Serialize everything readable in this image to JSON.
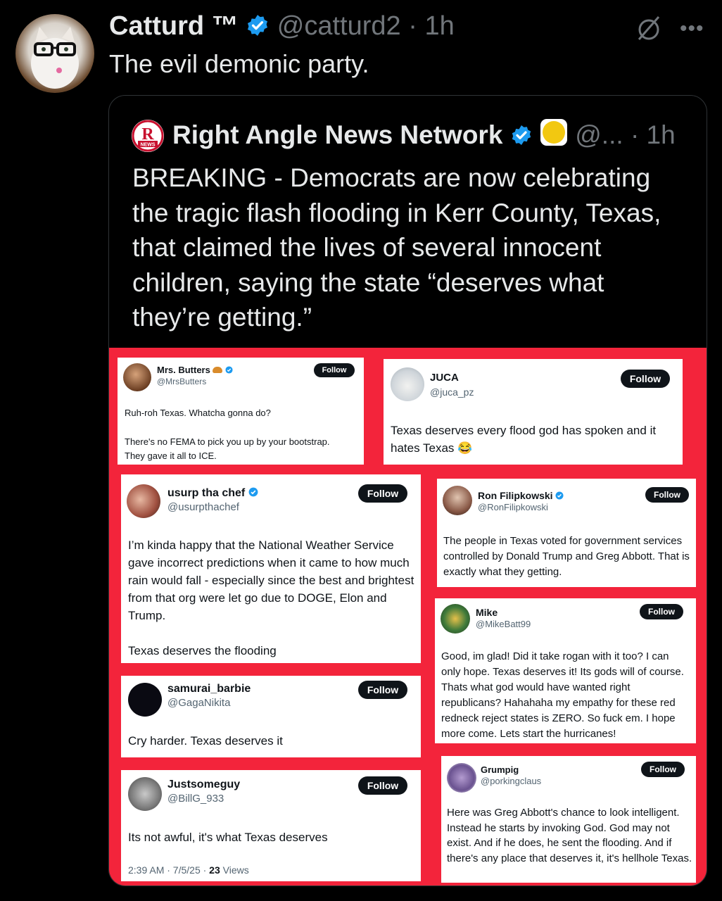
{
  "tweet": {
    "author_name": "Catturd ™",
    "handle": "@catturd2",
    "time": "· 1h",
    "text": "The evil demonic party.",
    "more": "•••"
  },
  "quote": {
    "logo_text": "R",
    "logo_sub": "NEWS",
    "author_name": "Right Angle News Network",
    "handle": "@...",
    "time": "· 1h",
    "text": "BREAKING - Democrats are now celebrating the tragic flash flooding in Kerr County, Texas, that claimed the lives of several innocent children, saying the state “deserves what they’re getting.”"
  },
  "cards": [
    {
      "name": "Mrs. Butters",
      "handle": "@MrsButters",
      "follow": "Follow",
      "body1": "Ruh-roh Texas. Whatcha gonna do?",
      "body2": "There's no FEMA to pick you up by your bootstrap. They gave it all to ICE."
    },
    {
      "name": "JUCA",
      "handle": "@juca_pz",
      "follow": "Follow",
      "body1": "Texas deserves every flood god has spoken and it hates Texas 😂"
    },
    {
      "name": "usurp tha chef",
      "handle": "@usurpthachef",
      "follow": "Follow",
      "body1": "I’m kinda happy that the National Weather Service gave incorrect predictions when it came to how much rain would fall - especially since the best and brightest from that org were let go due to DOGE, Elon and Trump.",
      "body2": "Texas deserves the flooding"
    },
    {
      "name": "Ron Filipkowski",
      "handle": "@RonFilipkowski",
      "follow": "Follow",
      "body1": "The people in Texas voted for government services controlled by Donald Trump and Greg Abbott. That is exactly what they getting."
    },
    {
      "name": "samurai_barbie",
      "handle": "@GagaNikita",
      "follow": "Follow",
      "body1": "Cry harder. Texas deserves it"
    },
    {
      "name": "Mike",
      "handle": "@MikeBatt99",
      "follow": "Follow",
      "body1": "Good, im glad! Did it take rogan with it too? I can only hope. Texas deserves it! Its gods will of course. Thats what god would have wanted right republicans? Hahahaha my empathy for these red redneck reject states is ZERO. So fuck em. I hope more come. Lets start the hurricanes!"
    },
    {
      "name": "Justsomeguy",
      "handle": "@BillG_933",
      "follow": "Follow",
      "body1": "Its not awful, it's what Texas deserves",
      "time": "2:39 AM · 7/5/25 · ",
      "views_num": "23",
      "views_label": " Views"
    },
    {
      "name": "Grumpig",
      "handle": "@porkingclaus",
      "follow": "Follow",
      "body1": "Here was Greg Abbott's chance to look intelligent. Instead he starts by invoking God. God may not exist. And if he does, he sent the flooding. And if there's any place that deserves it, it's hellhole Texas."
    }
  ],
  "colors": {
    "background": "#000000",
    "verified": "#1d9bf0",
    "collage_bg": "#f3243b",
    "muted": "#71767b"
  }
}
